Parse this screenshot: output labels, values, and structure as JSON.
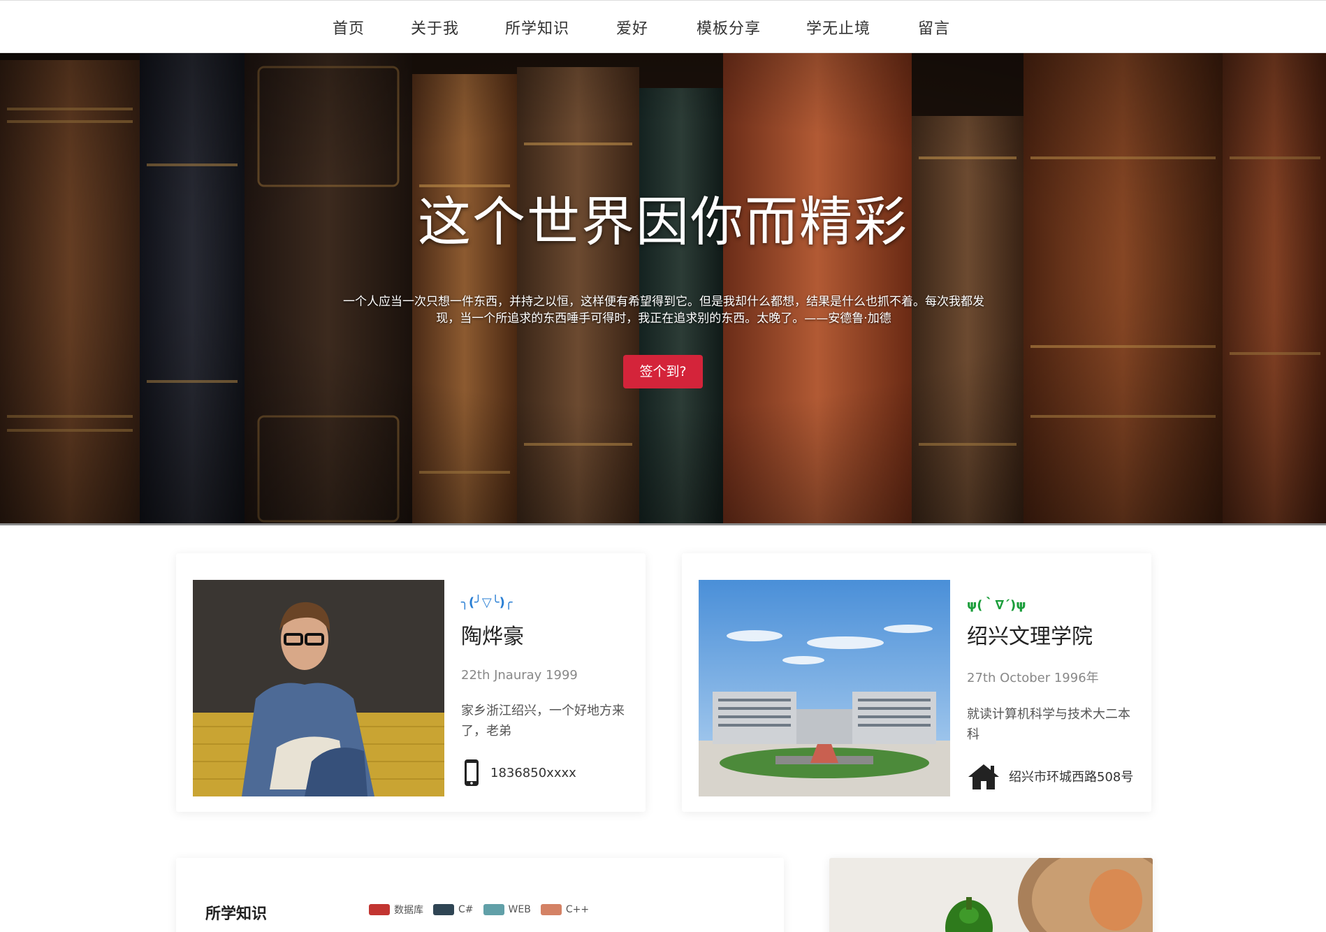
{
  "nav": {
    "items": [
      "首页",
      "关于我",
      "所学知识",
      "爱好",
      "模板分享",
      "学无止境",
      "留言"
    ]
  },
  "hero": {
    "title": "这个世界因你而精彩",
    "quote": "一个人应当一次只想一件东西，并持之以恒，这样便有希望得到它。但是我却什么都想，结果是什么也抓不着。每次我都发现，当一个所追求的东西唾手可得时，我正在追求别的东西。太晚了。——安德鲁·加德",
    "button_label": "签个到?"
  },
  "profile_card": {
    "kaomoji": "╮(╯▽╰)╭",
    "name": "陶烨豪",
    "date": "22th Jnauray 1999",
    "description": "家乡浙江绍兴，一个好地方来了，老弟",
    "phone": "1836850xxxx"
  },
  "school_card": {
    "kaomoji": "ψ(｀∇´)ψ",
    "name": "绍兴文理学院",
    "date": "27th October 1996年",
    "description": "就读计算机科学与技术大二本科",
    "address": "绍兴市环城西路508号"
  },
  "skills": {
    "title": "所学知识",
    "legend": [
      {
        "label": "数据库",
        "color": "#c23531"
      },
      {
        "label": "C#",
        "color": "#2f4554"
      },
      {
        "label": "WEB",
        "color": "#61a0a8"
      },
      {
        "label": "C++",
        "color": "#d48265"
      }
    ]
  },
  "colors": {
    "accent": "#d4243a",
    "kaomoji_blue": "#2a7fd4",
    "kaomoji_green": "#1a9d3a"
  }
}
